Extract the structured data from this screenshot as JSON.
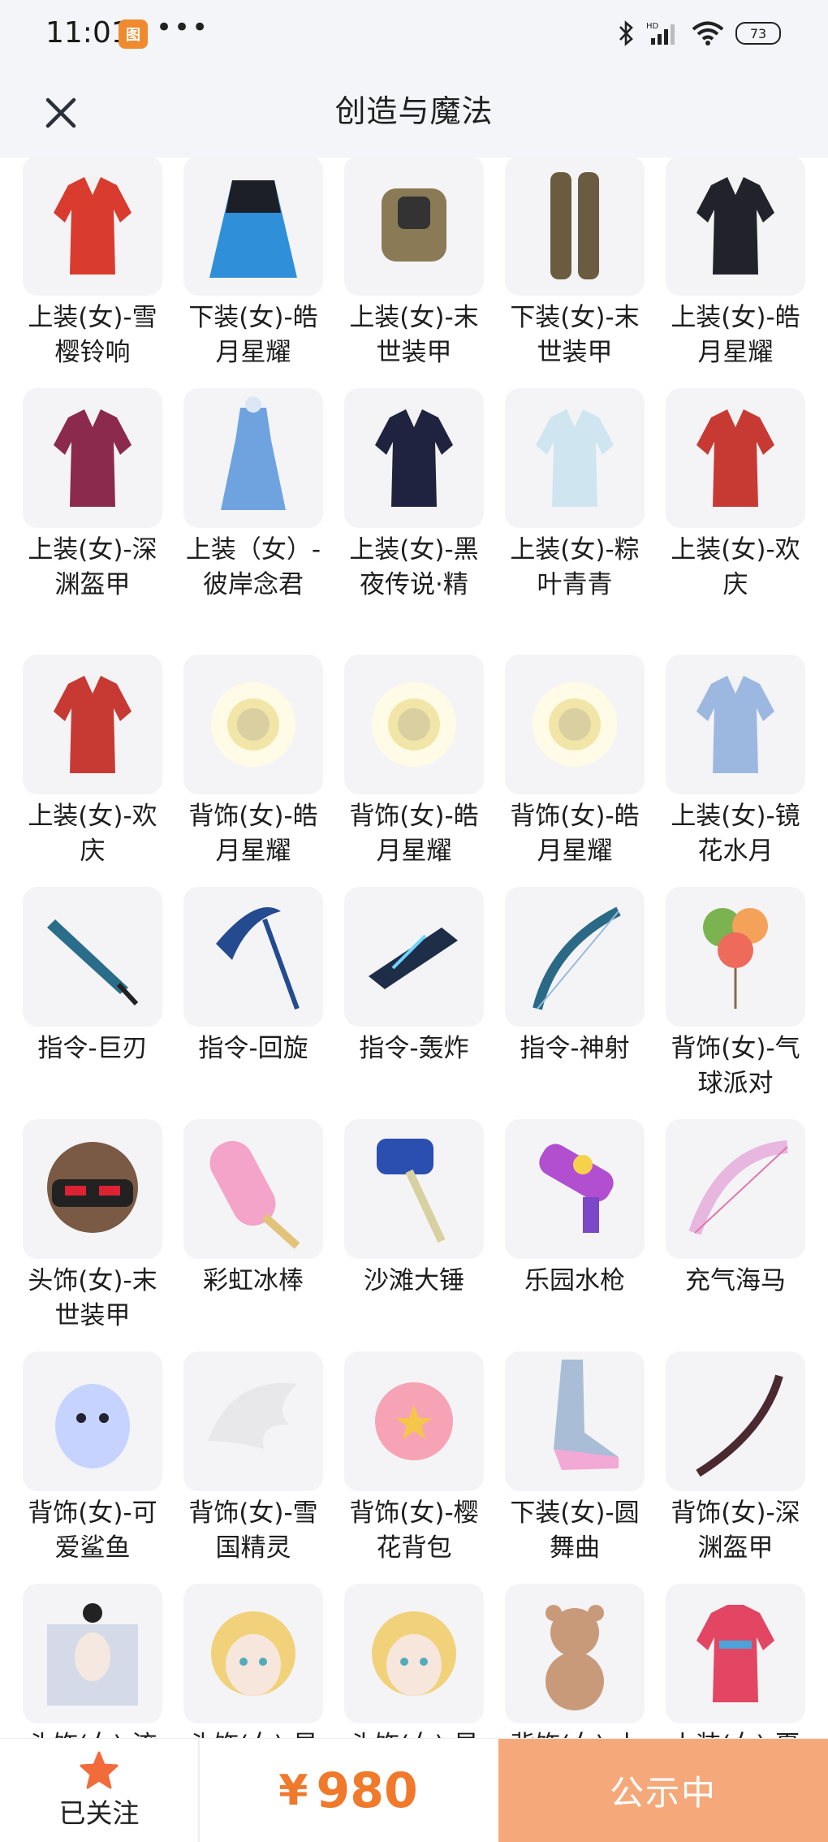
{
  "status_bar": {
    "time": "11:01",
    "app_badge": "图",
    "more": "•••",
    "battery": "73",
    "icons": [
      "bluetooth-icon",
      "signal-icon",
      "wifi-icon",
      "battery-icon"
    ]
  },
  "header": {
    "title": "创造与魔法",
    "close_icon": "close-icon"
  },
  "items": [
    {
      "label": "上装(女)-雪樱铃响",
      "color": "#d93b2f",
      "shape": "garment"
    },
    {
      "label": "下装(女)-皓月星耀",
      "color": "#2f8fd9",
      "shape": "skirt"
    },
    {
      "label": "上装(女)-末世装甲",
      "color": "#8a7a55",
      "shape": "armor"
    },
    {
      "label": "下装(女)-末世装甲",
      "color": "#6b5b40",
      "shape": "legs"
    },
    {
      "label": "上装(女)-皓月星耀",
      "color": "#22232a",
      "shape": "garment"
    },
    {
      "label": "上装(女)-深渊盔甲",
      "color": "#8b2a4c",
      "shape": "garment"
    },
    {
      "label": "上装（女）-彼岸念君",
      "color": "#6fa3e0",
      "shape": "dress"
    },
    {
      "label": "上装(女)-黑夜传说·精",
      "color": "#1f2340",
      "shape": "garment"
    },
    {
      "label": "上装(女)-粽叶青青",
      "color": "#cfe6f0",
      "shape": "garment"
    },
    {
      "label": "上装(女)-欢庆",
      "color": "#c73a33",
      "shape": "garment"
    },
    {
      "label": "上装(女)-欢庆",
      "color": "#c73a33",
      "shape": "garment"
    },
    {
      "label": "背饰(女)-皓月星耀",
      "color": "#f1e6a8",
      "shape": "orb"
    },
    {
      "label": "背饰(女)-皓月星耀",
      "color": "#f1e6a8",
      "shape": "orb"
    },
    {
      "label": "背饰(女)-皓月星耀",
      "color": "#f1e6a8",
      "shape": "orb"
    },
    {
      "label": "上装(女)-镜花水月",
      "color": "#9db8e0",
      "shape": "garment"
    },
    {
      "label": "指令-巨刃",
      "color": "#2a6d8a",
      "shape": "blade"
    },
    {
      "label": "指令-回旋",
      "color": "#244b8f",
      "shape": "scythe"
    },
    {
      "label": "指令-轰炸",
      "color": "#1e2d48",
      "shape": "claw"
    },
    {
      "label": "指令-神射",
      "color": "#2b6a86",
      "shape": "bow"
    },
    {
      "label": "背饰(女)-气球派对",
      "color": "#7ab34f",
      "shape": "balloons"
    },
    {
      "label": "头饰(女)-末世装甲",
      "color": "#7a5a44",
      "shape": "helmet"
    },
    {
      "label": "彩虹冰棒",
      "color": "#f4a4c8",
      "shape": "popsicle"
    },
    {
      "label": "沙滩大锤",
      "color": "#2a4fb0",
      "shape": "hammer"
    },
    {
      "label": "乐园水枪",
      "color": "#b24fd0",
      "shape": "gun"
    },
    {
      "label": "充气海马",
      "color": "#e7b7e0",
      "shape": "bowpink"
    },
    {
      "label": "背饰(女)-可爱鲨鱼",
      "color": "#c7d3ff",
      "shape": "shark"
    },
    {
      "label": "背饰(女)-雪国精灵",
      "color": "#e8e8ea",
      "shape": "wings"
    },
    {
      "label": "背饰(女)-樱花背包",
      "color": "#f6a3b5",
      "shape": "sakura"
    },
    {
      "label": "下装(女)-圆舞曲",
      "color": "#f3a9d6",
      "shape": "heel"
    },
    {
      "label": "背饰(女)-深渊盔甲",
      "color": "#4a2a30",
      "shape": "katana"
    },
    {
      "label": "头饰(女)-流天纱",
      "color": "#d4dae8",
      "shape": "veil"
    },
    {
      "label": "头饰(女)-星辉",
      "color": "#f1d27a",
      "shape": "head"
    },
    {
      "label": "头饰(女)-星辉",
      "color": "#f1d27a",
      "shape": "head"
    },
    {
      "label": "背饰(女)-小熊",
      "color": "#c99a7a",
      "shape": "bear"
    },
    {
      "label": "上装(女)-夏日",
      "color": "#e24663",
      "shape": "jacket"
    }
  ],
  "bottom": {
    "follow_label": "已关注",
    "currency": "¥",
    "price": "980",
    "status_label": "公示中"
  }
}
